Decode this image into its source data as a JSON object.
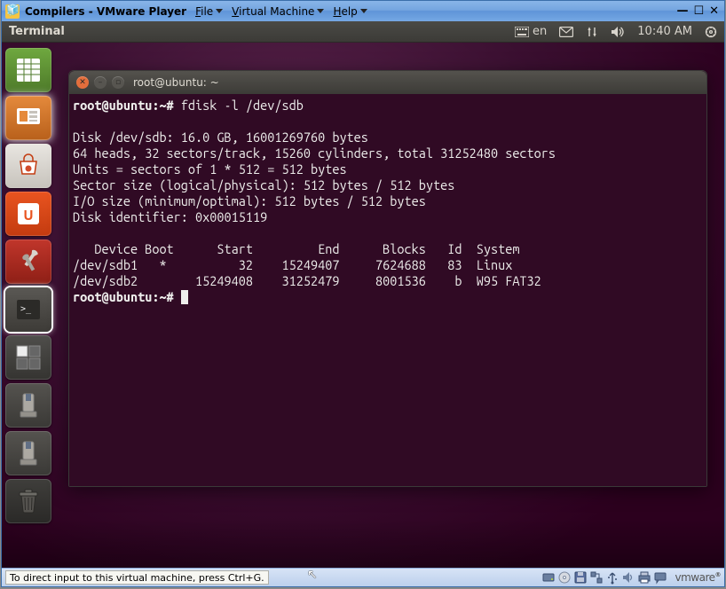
{
  "vmware": {
    "title": "Compilers - VMware Player",
    "menus": [
      "File",
      "Virtual Machine",
      "Help"
    ],
    "statusHint": "To direct input to this virtual machine, press Ctrl+G.",
    "logo": "vmware"
  },
  "ubuntu": {
    "menubarTitle": "Terminal",
    "lang": "en",
    "time": "10:40 AM"
  },
  "launcher": {
    "items": [
      {
        "name": "libreoffice-calc",
        "cls": "calc"
      },
      {
        "name": "libreoffice-impress",
        "cls": "impress"
      },
      {
        "name": "software-center",
        "cls": "shop"
      },
      {
        "name": "ubuntu-one",
        "cls": "ubuntu"
      },
      {
        "name": "system-settings",
        "cls": "settings"
      },
      {
        "name": "terminal",
        "cls": "terminal"
      },
      {
        "name": "workspace-switcher",
        "cls": "workspaces"
      },
      {
        "name": "removable-drive-1",
        "cls": "drive"
      },
      {
        "name": "removable-drive-2",
        "cls": "drive"
      },
      {
        "name": "trash",
        "cls": "trash"
      }
    ]
  },
  "terminal": {
    "title": "root@ubuntu: ~",
    "promptUserHost": "root@ubuntu",
    "promptPath": "~",
    "promptChar": "#",
    "command": "fdisk -l /dev/sdb",
    "lines": [
      "",
      "Disk /dev/sdb: 16.0 GB, 16001269760 bytes",
      "64 heads, 32 sectors/track, 15260 cylinders, total 31252480 sectors",
      "Units = sectors of 1 * 512 = 512 bytes",
      "Sector size (logical/physical): 512 bytes / 512 bytes",
      "I/O size (minimum/optimal): 512 bytes / 512 bytes",
      "Disk identifier: 0x00015119",
      "",
      "   Device Boot      Start         End      Blocks   Id  System",
      "/dev/sdb1   *          32    15249407     7624688   83  Linux",
      "/dev/sdb2        15249408    31252479     8001536    b  W95 FAT32"
    ],
    "partitionTable": {
      "columns": [
        "Device",
        "Boot",
        "Start",
        "End",
        "Blocks",
        "Id",
        "System"
      ],
      "rows": [
        {
          "Device": "/dev/sdb1",
          "Boot": "*",
          "Start": 32,
          "End": 15249407,
          "Blocks": 7624688,
          "Id": "83",
          "System": "Linux"
        },
        {
          "Device": "/dev/sdb2",
          "Boot": "",
          "Start": 15249408,
          "End": 31252479,
          "Blocks": 8001536,
          "Id": "b",
          "System": "W95 FAT32"
        }
      ]
    }
  }
}
